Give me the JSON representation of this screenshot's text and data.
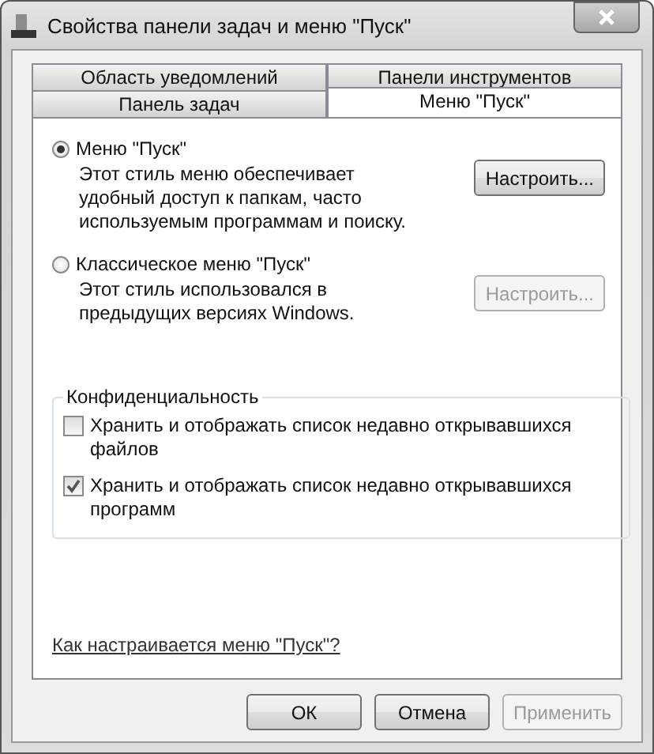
{
  "window": {
    "title": "Свойства панели задач и меню \"Пуск\""
  },
  "tab_rows": [
    [
      {
        "label": "Область уведомлений",
        "selected": false
      },
      {
        "label": "Панели инструментов",
        "selected": false
      }
    ],
    [
      {
        "label": "Панель задач",
        "selected": false
      },
      {
        "label": "Меню \"Пуск\"",
        "selected": true
      }
    ]
  ],
  "options": [
    {
      "label": "Меню \"Пуск\"",
      "selected": true,
      "description": "Этот стиль меню обеспечивает удобный доступ к папкам, часто используемым программам и поиску.",
      "button": {
        "label": "Настроить...",
        "disabled": false
      }
    },
    {
      "label": "Классическое меню \"Пуск\"",
      "selected": false,
      "description": "Этот стиль использовался в предыдущих версиях Windows.",
      "button": {
        "label": "Настроить...",
        "disabled": true
      }
    }
  ],
  "privacy": {
    "title": "Конфиденциальность",
    "items": [
      {
        "label": "Хранить и отображать список недавно открывавшихся файлов",
        "checked": false
      },
      {
        "label": "Хранить и отображать список недавно открывавшихся программ",
        "checked": true
      }
    ]
  },
  "help_link": "Как настраивается меню \"Пуск\"?",
  "buttons": [
    {
      "label": "ОК",
      "disabled": false
    },
    {
      "label": "Отмена",
      "disabled": false
    },
    {
      "label": "Применить",
      "disabled": true
    }
  ]
}
